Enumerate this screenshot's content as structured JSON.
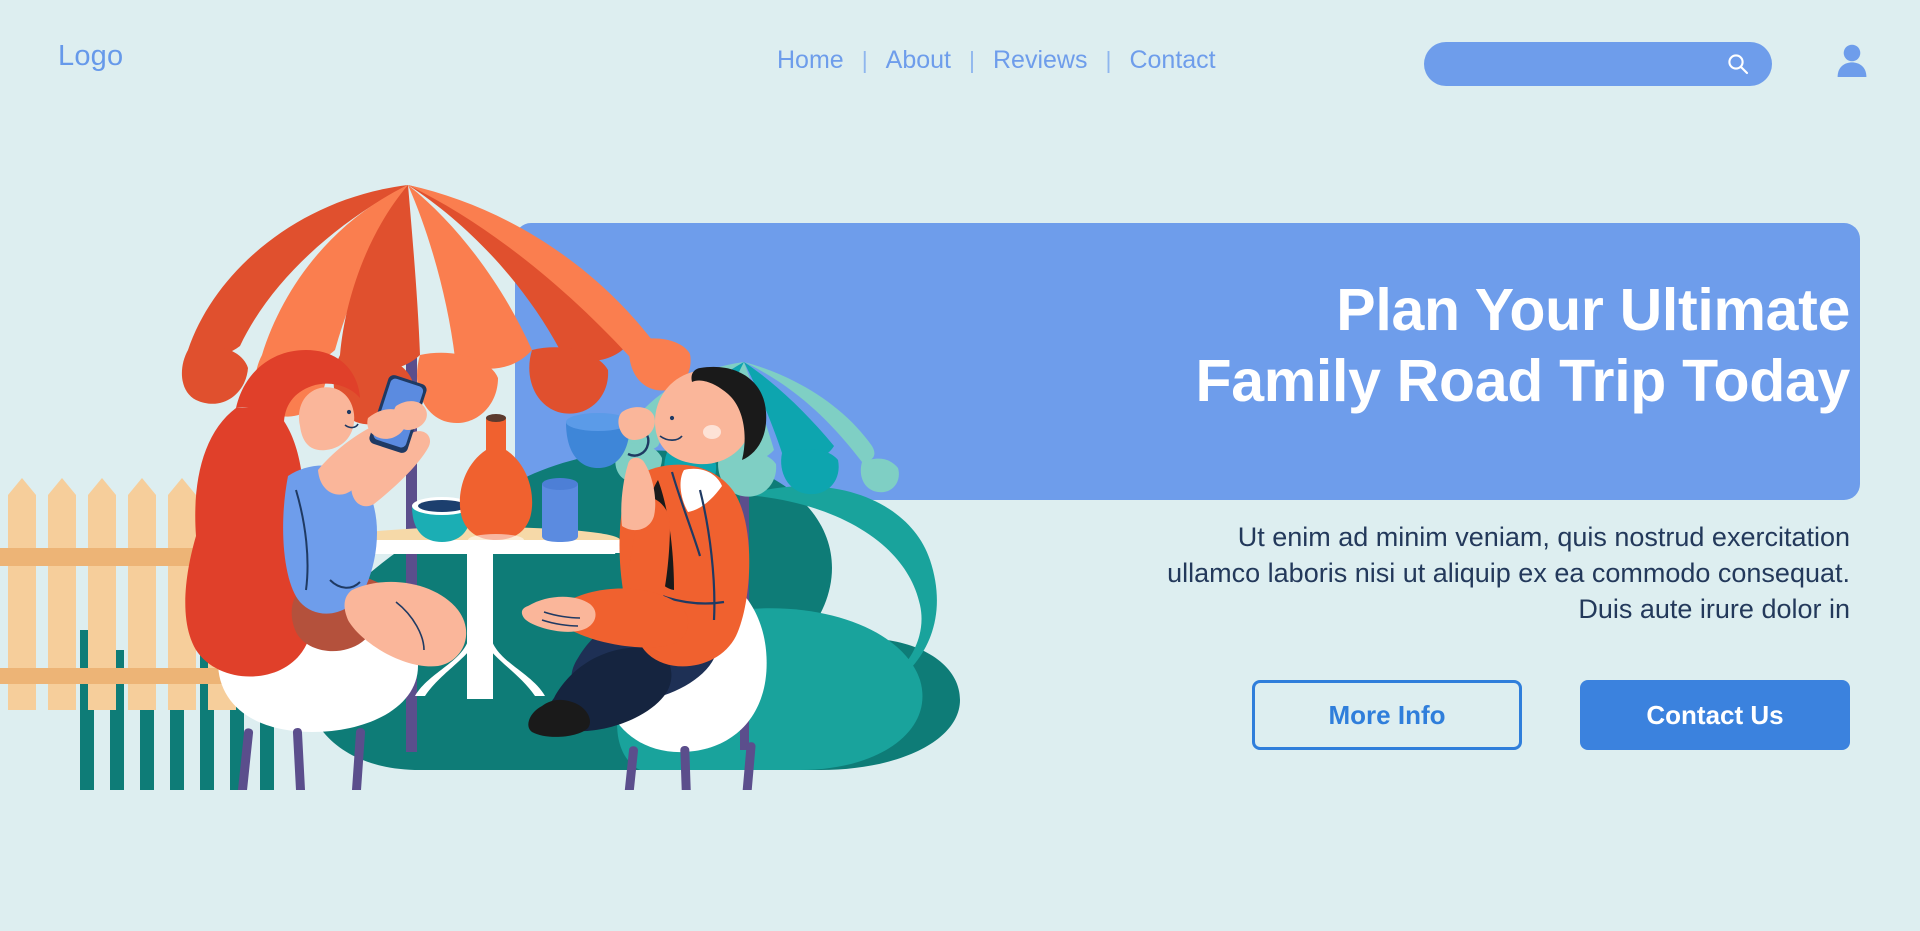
{
  "header": {
    "logo": "Logo",
    "nav": [
      {
        "label": "Home"
      },
      {
        "label": "About"
      },
      {
        "label": "Reviews"
      },
      {
        "label": "Contact"
      }
    ],
    "separator": "|",
    "search": {
      "value": "",
      "placeholder": ""
    },
    "icons": {
      "search": "search-icon",
      "account": "user-account-icon"
    }
  },
  "hero": {
    "title_line1": "Plan Your Ultimate",
    "title_line2": "Family Road Trip Today",
    "paragraph": "Ut enim ad minim veniam, quis nostrud exercitation ullamco laboris nisi ut aliquip ex ea commodo consequat. Duis aute irure dolor in",
    "primary_button": "Contact Us",
    "secondary_button": "More Info"
  },
  "colors": {
    "page_background": "#DDEEF0",
    "brand_blue": "#6E9DEB",
    "accent_blue": "#3B82DE",
    "outline_blue": "#2F7EDB",
    "heading_white": "#FFFFFF",
    "body_text": "#23395B",
    "umbrella_orange_dark": "#E0502E",
    "umbrella_orange_light": "#FA7E4F",
    "umbrella_teal_light": "#7FCFC4",
    "umbrella_teal_dark": "#0DA5AF",
    "bush_teal": "#0E7C77",
    "fence_tan": "#F6CE9B",
    "fence_rail": "#EDB476",
    "hair_red": "#E0402A",
    "skin": "#FAB69A",
    "shirt_blue": "#6E9DEB",
    "shorts_brown": "#B4513C",
    "jacket_orange": "#F0612F",
    "pants_navy": "#1E3055",
    "chair_white": "#FFFFFF",
    "chair_leg_purple": "#5B4E8C"
  },
  "illustration": {
    "name": "outdoor-cafe-couple-illustration",
    "elements": [
      "orange-patio-umbrella",
      "teal-patio-umbrella",
      "woman-with-phone",
      "man-with-coffee-cup",
      "round-cafe-table",
      "orange-vase",
      "teal-bowl",
      "blue-cup",
      "wooden-picket-fence",
      "teal-bushes"
    ]
  }
}
